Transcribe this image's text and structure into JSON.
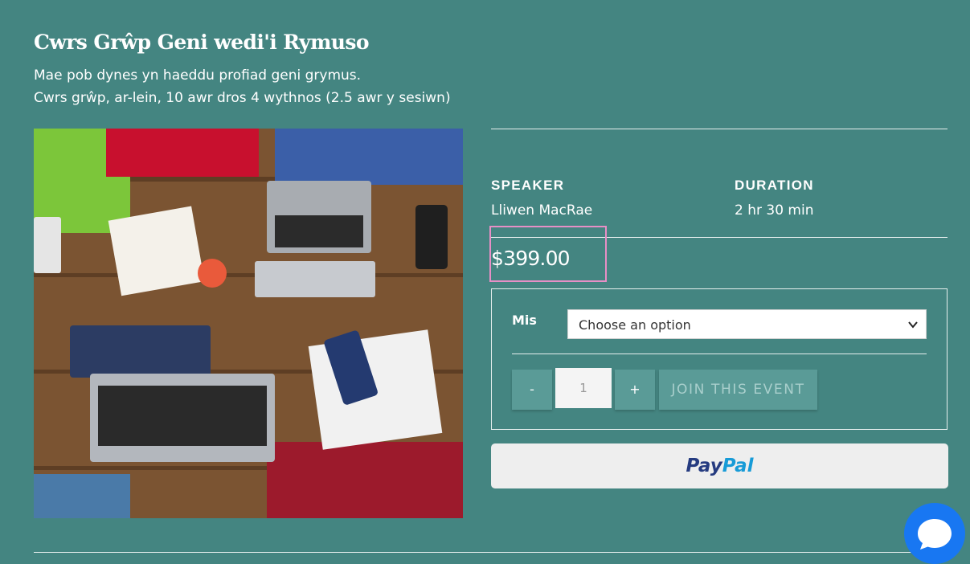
{
  "event": {
    "title": "Cwrs Grŵp Geni wedi'i Rymuso",
    "subtitle_line1": "Mae pob dynes yn haeddu profiad geni grymus.",
    "subtitle_line2": "Cwrs grŵp, ar-lein, 10 awr dros 4 wythnos (2.5 awr y sesiwn)"
  },
  "details": {
    "speaker_label": "SPEAKER",
    "speaker_value": "Lliwen MacRae",
    "duration_label": "DURATION",
    "duration_value": "2 hr 30 min"
  },
  "price": "$399.00",
  "form": {
    "month_label": "Mis",
    "select_value": "Choose an option",
    "minus_label": "-",
    "quantity": "1",
    "plus_label": "+",
    "join_label": "JOIN THIS EVENT"
  },
  "paypal": {
    "pay": "Pay",
    "pal": "Pal"
  },
  "colors": {
    "background": "#448581",
    "highlight_box": "#e78fc6",
    "button": "#5a9b97",
    "chat": "#1877f2"
  },
  "icons": {
    "select_chevron": "chevron-down-icon",
    "chat": "chat-bubble-icon"
  }
}
